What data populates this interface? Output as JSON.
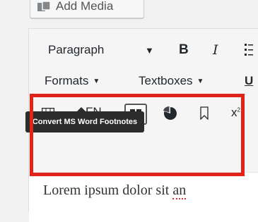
{
  "add_media": {
    "label": "Add Media"
  },
  "toolbar": {
    "paragraph_select": "Paragraph",
    "bold": "B",
    "italic": "I",
    "formats": "Formats",
    "textboxes": "Textboxes",
    "underline": "U",
    "fn": "FN",
    "superscript_base": "x",
    "superscript_exp": "2"
  },
  "tooltip": {
    "text": "Convert MS Word Footnotes"
  },
  "content": {
    "text_start": "Lorem ipsum dolor sit ",
    "text_squiggle": "an"
  },
  "colors": {
    "highlight": "#e2231a",
    "tooltip_bg": "#2c2c2c"
  }
}
